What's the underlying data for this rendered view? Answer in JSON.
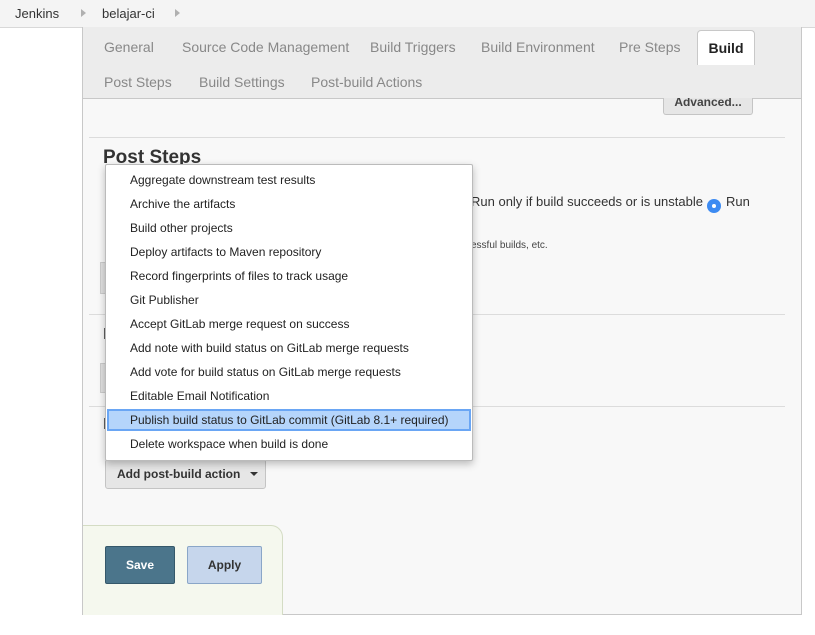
{
  "breadcrumb": {
    "items": [
      "Jenkins",
      "belajar-ci"
    ]
  },
  "tabs": {
    "row1": [
      "General",
      "Source Code Management",
      "Build Triggers",
      "Build Environment",
      "Pre Steps"
    ],
    "active": "Build",
    "row2": [
      "Post Steps",
      "Build Settings",
      "Post-build Actions"
    ]
  },
  "advanced_label": "Advanced...",
  "post_steps": {
    "title": "Post Steps",
    "radio_succeeds": "Run only if build succeeds or is unstable",
    "radio_run": "Run",
    "help": "essful builds, etc.",
    "stub_letter_1": "I",
    "stub_letter_2": "I"
  },
  "menu": {
    "items": [
      "Aggregate downstream test results",
      "Archive the artifacts",
      "Build other projects",
      "Deploy artifacts to Maven repository",
      "Record fingerprints of files to track usage",
      "Git Publisher",
      "Accept GitLab merge request on success",
      "Add note with build status on GitLab merge requests",
      "Add vote for build status on GitLab merge requests",
      "Editable Email Notification",
      "Publish build status to GitLab commit (GitLab 8.1+ required)",
      "Delete workspace when build is done"
    ],
    "highlighted": "Publish build status to GitLab commit (GitLab 8.1+ required)"
  },
  "add_post_build_action": "Add post-build action",
  "buttons": {
    "save": "Save",
    "apply": "Apply"
  },
  "colors": {
    "accent": "#4b758b",
    "highlight": "#b5d5fb",
    "radio": "#3d8bf2"
  }
}
